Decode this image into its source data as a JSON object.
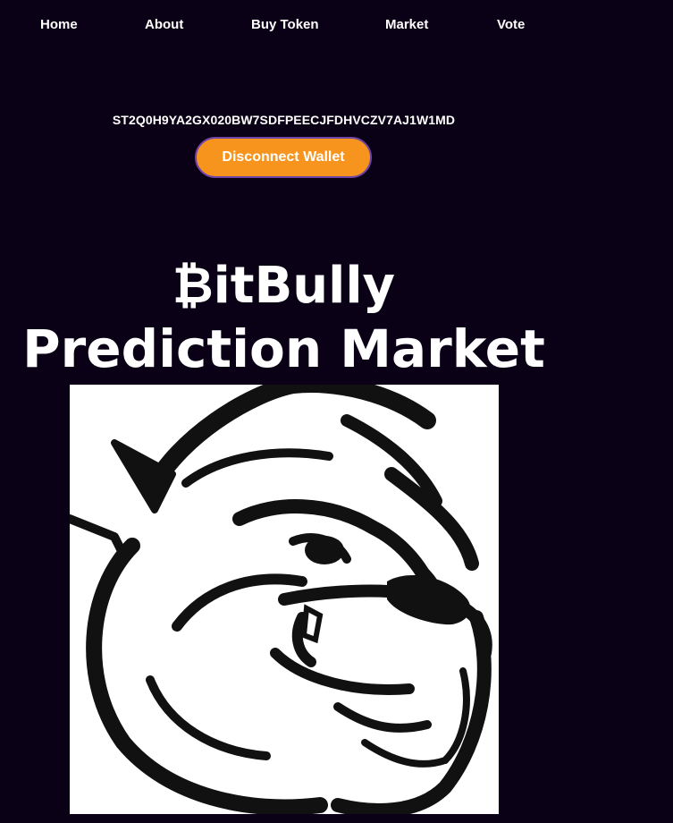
{
  "nav": {
    "items": [
      {
        "label": "Home"
      },
      {
        "label": "About"
      },
      {
        "label": "Buy Token"
      },
      {
        "label": "Market"
      },
      {
        "label": "Vote"
      }
    ]
  },
  "wallet": {
    "address": "ST2Q0H9YA2GX020BW7SDFPEECJFDHVCZV7AJ1W1MD",
    "disconnect_label": "Disconnect Wallet"
  },
  "hero": {
    "title_line1": "₿itBully",
    "title_line2": "Prediction Market"
  },
  "colors": {
    "background": "#0b0116",
    "button": "#f7941d",
    "button_border": "#6f45a6",
    "text": "#ffffff"
  },
  "images": {
    "mascot": "bulldog-mascot"
  }
}
